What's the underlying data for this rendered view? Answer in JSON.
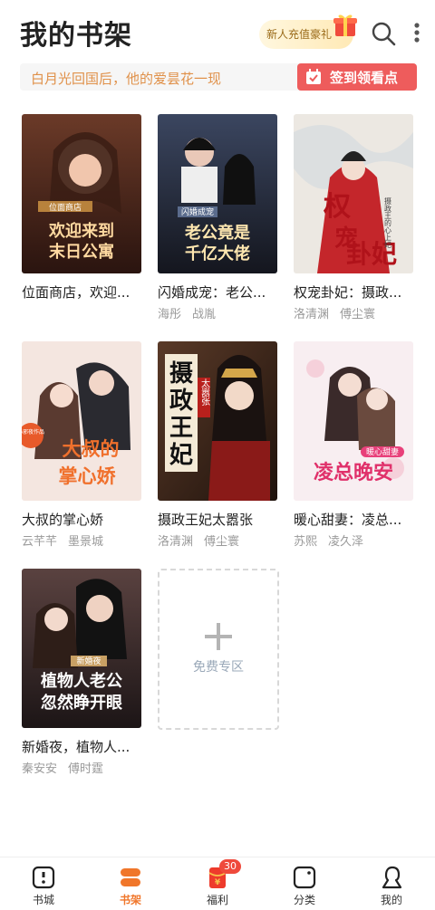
{
  "header": {
    "title": "我的书架",
    "promo_label": "新人充值豪礼",
    "icons": [
      "gift-icon",
      "search-icon",
      "more-vert-icon"
    ]
  },
  "notice": {
    "text": "白月光回国后，他的爱昙花一现",
    "checkin_label": "签到领看点"
  },
  "books": [
    {
      "title": "位面商店，欢迎...",
      "authors": [
        "",
        ""
      ],
      "cover_text": "欢迎来到末日公寓",
      "cover_badge": "位面商店",
      "cover_color": "#4a2a20"
    },
    {
      "title": "闪婚成宠：老公...",
      "authors": [
        "海彤",
        "战胤"
      ],
      "cover_text": "老公竟是千亿大佬",
      "cover_badge": "闪婚成宠",
      "cover_color": "#2a2f3c"
    },
    {
      "title": "权宠卦妃：摄政...",
      "authors": [
        "洛清渊",
        "傅尘寰"
      ],
      "cover_text": "权宠卦妃",
      "cover_badge": "摄政王的心上妃",
      "cover_color": "#e6e2dc"
    },
    {
      "title": "大叔的掌心娇",
      "authors": [
        "云芊芊",
        "墨景城"
      ],
      "cover_text": "大叔的掌心娇",
      "cover_badge": "小邪夜作品",
      "cover_color": "#f3e4de"
    },
    {
      "title": "摄政王妃太嚣张",
      "authors": [
        "洛清渊",
        "傅尘寰"
      ],
      "cover_text": "摄政王妃",
      "cover_badge": "太嚣张",
      "cover_color": "#3a2418"
    },
    {
      "title": "暖心甜妻：凌总...",
      "authors": [
        "苏熙",
        "凌久泽"
      ],
      "cover_text": "凌总晚安",
      "cover_badge": "暖心甜妻",
      "cover_color": "#f7eef0"
    },
    {
      "title": "新婚夜，植物人...",
      "authors": [
        "秦安安",
        "傅时霆"
      ],
      "cover_text": "植物人老公忽然睁开眼",
      "cover_badge": "新婚夜",
      "cover_color": "#2e2526"
    }
  ],
  "add_slot": {
    "label": "免费专区"
  },
  "tabs": [
    {
      "label": "书城",
      "icon": "book-store-icon",
      "active": false
    },
    {
      "label": "书架",
      "icon": "bookshelf-icon",
      "active": true
    },
    {
      "label": "福利",
      "icon": "red-envelope-icon",
      "active": false,
      "badge": "30"
    },
    {
      "label": "分类",
      "icon": "category-icon",
      "active": false
    },
    {
      "label": "我的",
      "icon": "profile-icon",
      "active": false
    }
  ],
  "colors": {
    "accent": "#f0762a",
    "checkin_bg": "#ee5c5c",
    "notice_text": "#e0914a"
  }
}
